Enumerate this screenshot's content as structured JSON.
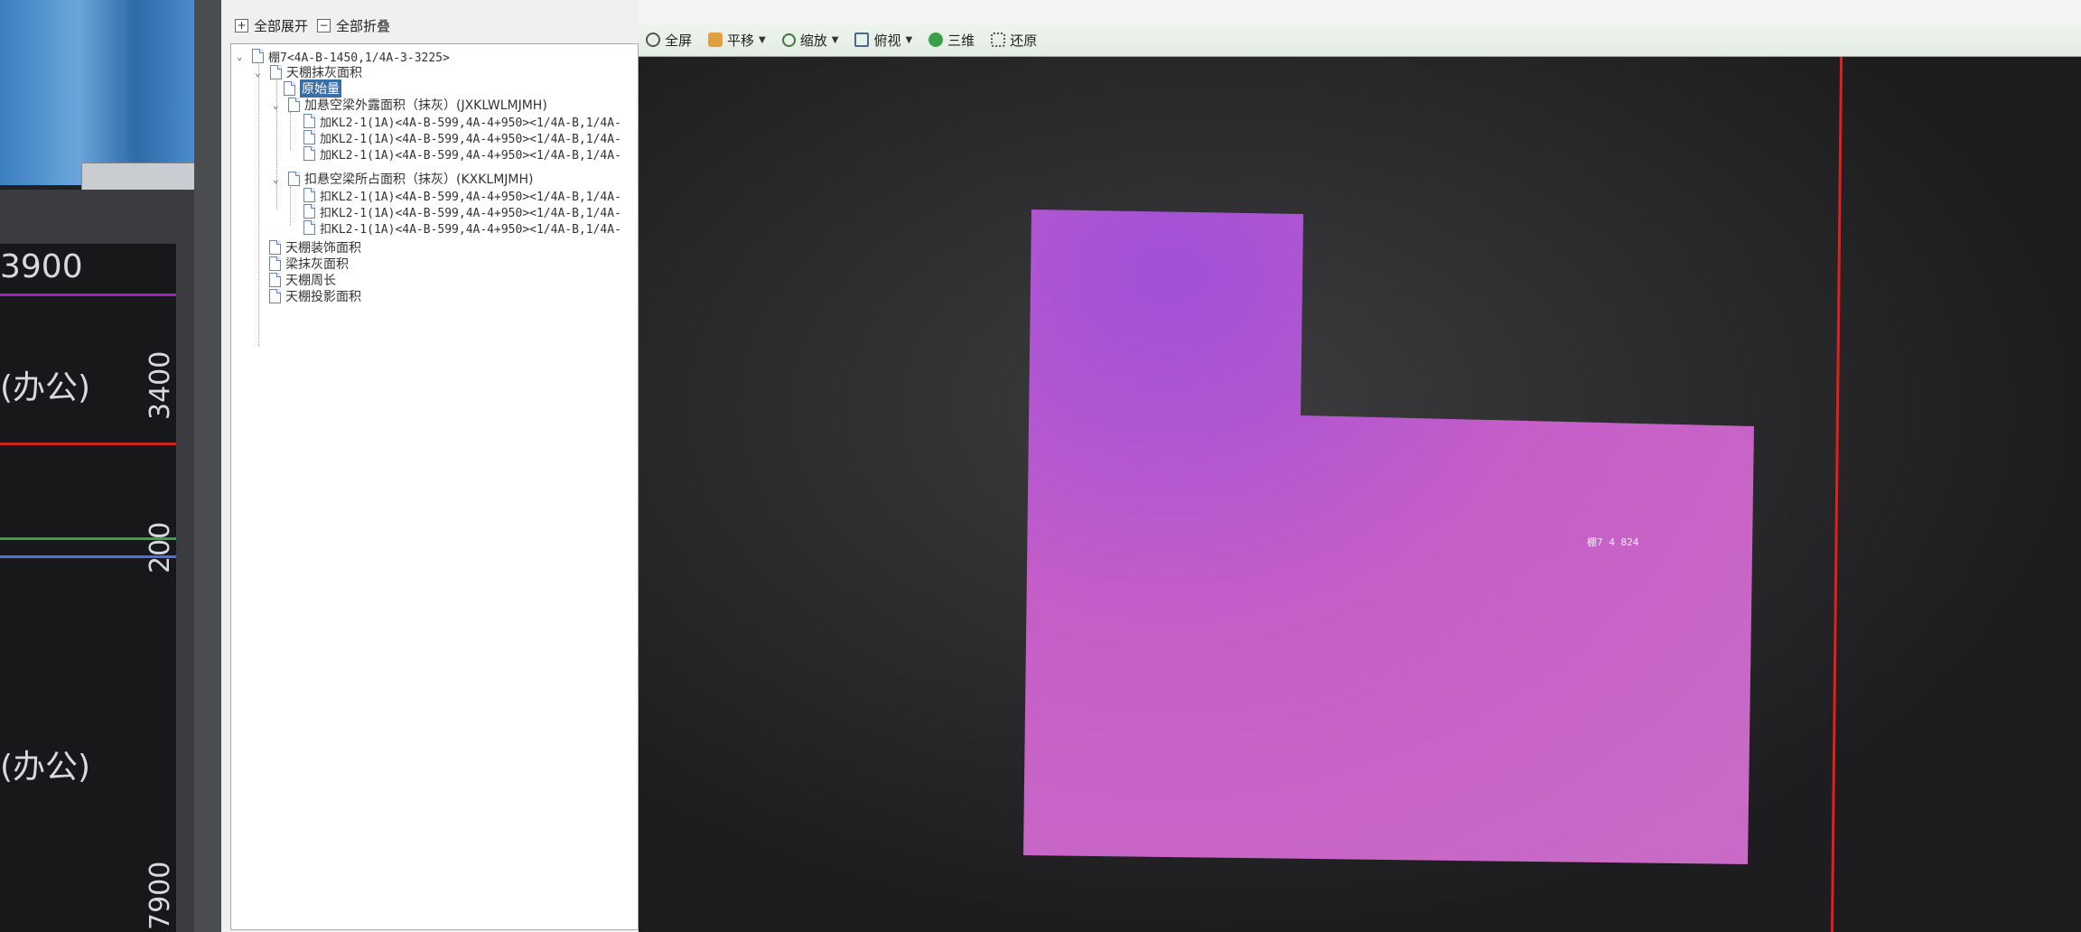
{
  "tree_toolbar": {
    "expand_all": "全部展开",
    "collapse_all": "全部折叠"
  },
  "tree": {
    "root": "棚7<4A-B-1450,1/4A-3-3225>",
    "n1": "天棚抹灰面积",
    "n1_1": "原始量",
    "n1_2": "加悬空梁外露面积（抹灰）(JXKLWLMJMH)",
    "n1_2_items": [
      "加KL2-1(1A)<4A-B-599,4A-4+950><1/4A-B,1/4A-",
      "加KL2-1(1A)<4A-B-599,4A-4+950><1/4A-B,1/4A-",
      "加KL2-1(1A)<4A-B-599,4A-4+950><1/4A-B,1/4A-"
    ],
    "n1_3": "扣悬空梁所占面积（抹灰）(KXKLMJMH)",
    "n1_3_items": [
      "扣KL2-1(1A)<4A-B-599,4A-4+950><1/4A-B,1/4A-",
      "扣KL2-1(1A)<4A-B-599,4A-4+950><1/4A-B,1/4A-",
      "扣KL2-1(1A)<4A-B-599,4A-4+950><1/4A-B,1/4A-"
    ],
    "n2": "天棚装饰面积",
    "n3": "梁抹灰面积",
    "n4": "天棚周长",
    "n5": "天棚投影面积"
  },
  "viewport_toolbar": {
    "fullscreen": "全屏",
    "pan": "平移",
    "zoom": "缩放",
    "top_view": "俯视",
    "three_d": "三维",
    "restore": "还原"
  },
  "shape": {
    "label": "棚7 4 824",
    "fill": "#c560c8"
  },
  "background_window": {
    "dim_top": "3900",
    "dim_3400": "3400",
    "dim_200": "200",
    "dim_7900": "7900",
    "room_label_1": "(办公)",
    "room_label_2": "(办公)"
  }
}
